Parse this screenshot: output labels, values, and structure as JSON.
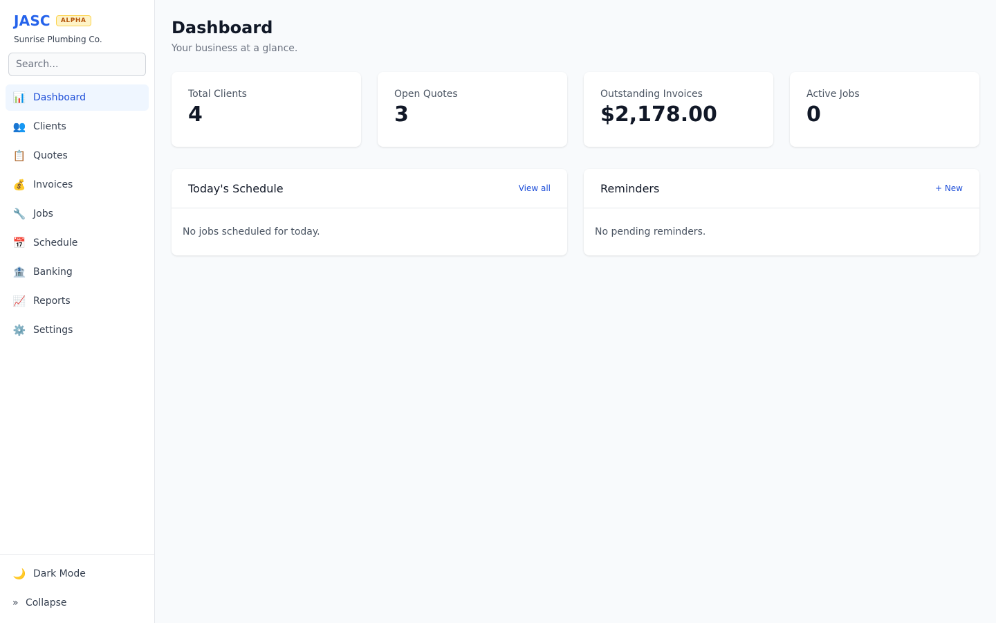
{
  "brand": {
    "name": "JASC",
    "badge": "ALPHA",
    "company": "Sunrise Plumbing Co."
  },
  "search": {
    "placeholder": "Search..."
  },
  "nav": [
    {
      "label": "Dashboard",
      "icon": "📊",
      "active": true
    },
    {
      "label": "Clients",
      "icon": "👥"
    },
    {
      "label": "Quotes",
      "icon": "📋"
    },
    {
      "label": "Invoices",
      "icon": "💰"
    },
    {
      "label": "Jobs",
      "icon": "🔧"
    },
    {
      "label": "Schedule",
      "icon": "📅"
    },
    {
      "label": "Banking",
      "icon": "🏦"
    },
    {
      "label": "Reports",
      "icon": "📈"
    },
    {
      "label": "Settings",
      "icon": "⚙️"
    }
  ],
  "footer": {
    "dark_mode": {
      "label": "Dark Mode",
      "icon": "🌙"
    },
    "collapse": {
      "label": "Collapse",
      "icon": "»"
    }
  },
  "page": {
    "title": "Dashboard",
    "subtitle": "Your business at a glance."
  },
  "stats": [
    {
      "label": "Total Clients",
      "value": "4"
    },
    {
      "label": "Open Quotes",
      "value": "3"
    },
    {
      "label": "Outstanding Invoices",
      "value": "$2,178.00"
    },
    {
      "label": "Active Jobs",
      "value": "0"
    }
  ],
  "schedule": {
    "title": "Today's Schedule",
    "link": "View all",
    "empty": "No jobs scheduled for today."
  },
  "reminders": {
    "title": "Reminders",
    "link": "+ New",
    "empty": "No pending reminders."
  },
  "colors": {
    "accent": "#2563eb",
    "active_bg": "#eff6ff",
    "background": "#f8fafc"
  }
}
